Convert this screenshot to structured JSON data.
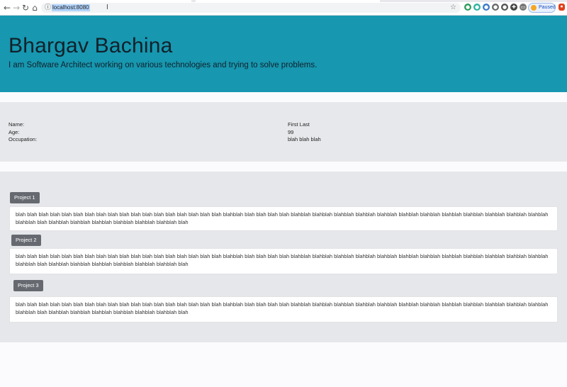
{
  "browser": {
    "url": "localhost:8080",
    "back_icon": "back-arrow-icon",
    "forward_icon": "forward-arrow-icon",
    "reload_icon": "reload-icon",
    "home_icon": "home-icon",
    "profile_status": "Paused"
  },
  "hero": {
    "title": "Bhargav Bachina",
    "subtitle": "I am Software Architect working on various technologies and trying to solve problems.",
    "background_color": "#1797b0"
  },
  "profile": {
    "labels": [
      "Name:",
      "Age:",
      "Occupation:"
    ],
    "values": [
      "First Last",
      "99",
      "blah blah blah"
    ]
  },
  "projects": [
    {
      "title": "Project 1",
      "description": "blah blah blah blah blah blah blah blah blah blah blah blah blah blah blah blah blah blah blahblah blah blah blah blah blahblah blahblah blahblah blahblah blahblah blahblah blahblah blahblah blahblah blahblah blahblah blahblah blahblah blah blahblah blahblah blahblah blahblah blahblah blahblah blah"
    },
    {
      "title": "Project 2",
      "description": "blah blah blah blah blah blah blah blah blah blah blah blah blah blah blah blah blah blah blahblah blah blah blah blah blahblah blahblah blahblah blahblah blahblah blahblah blahblah blahblah blahblah blahblah blahblah blahblah blahblah blah blahblah blahblah blahblah blahblah blahblah blahblah blah"
    },
    {
      "title": "Project 3",
      "description": "blah blah blah blah blah blah blah blah blah blah blah blah blah blah blah blah blah blah blahblah blah blah blah blah blahblah blahblah blahblah blahblah blahblah blahblah blahblah blahblah blahblah blahblah blahblah blahblah blahblah blah blahblah blahblah blahblah blahblah blahblah blahblah blah"
    }
  ]
}
